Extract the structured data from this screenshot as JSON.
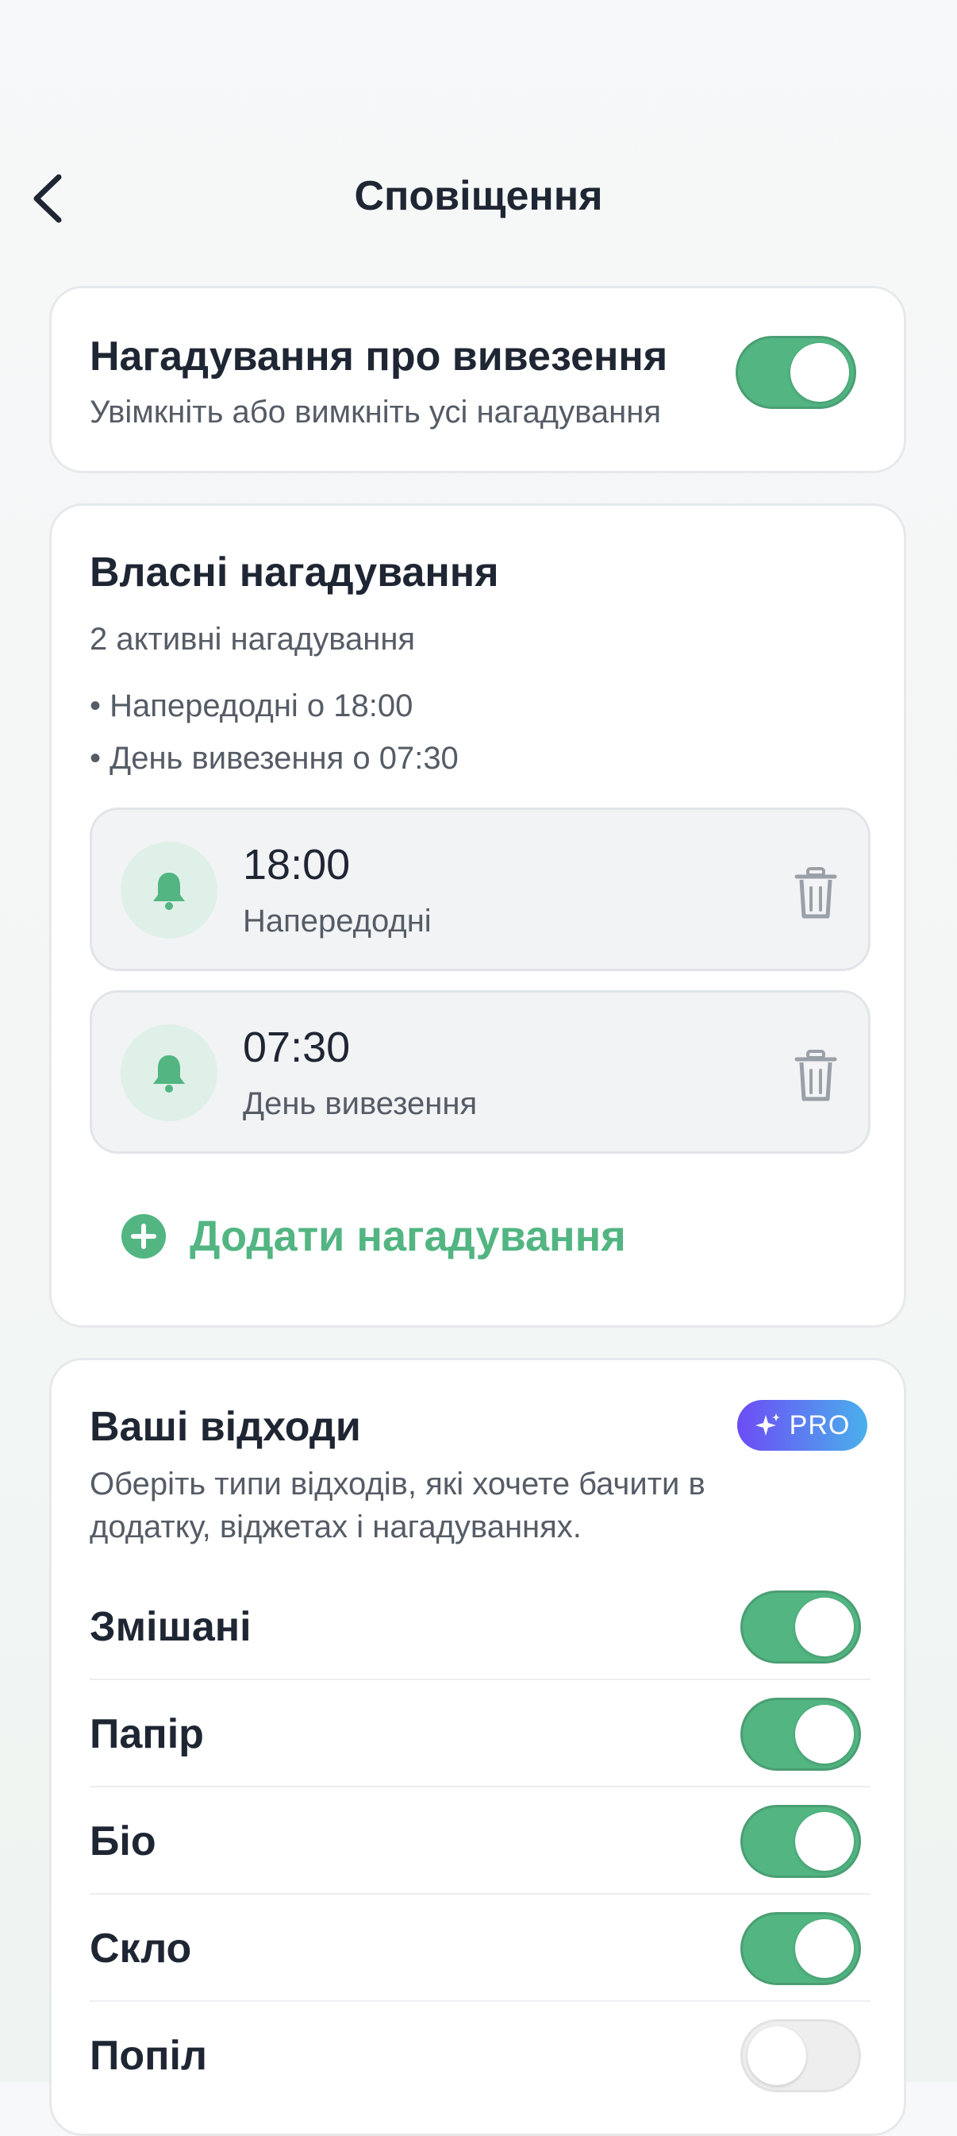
{
  "header": {
    "title": "Сповіщення"
  },
  "master": {
    "title": "Нагадування про вивезення",
    "subtitle": "Увімкніть або вимкніть усі нагадування",
    "enabled": true
  },
  "custom": {
    "title": "Власні нагадування",
    "count_text": "2 активні нагадування",
    "summary": [
      "• Напередодні о 18:00",
      "• День вивезення о 07:30"
    ],
    "reminders": [
      {
        "time": "18:00",
        "label": "Напередодні"
      },
      {
        "time": "07:30",
        "label": "День вивезення"
      }
    ],
    "add_label": "Додати нагадування"
  },
  "waste": {
    "title": "Ваші відходи",
    "pro_badge": "PRO",
    "description_line1": "Оберіть типи відходів, які хочете бачити в",
    "description_line2": "додатку, віджетах і нагадуваннях.",
    "types": [
      {
        "name": "Змішані",
        "enabled": true
      },
      {
        "name": "Папір",
        "enabled": true
      },
      {
        "name": "Біо",
        "enabled": true
      },
      {
        "name": "Скло",
        "enabled": true
      },
      {
        "name": "Попіл",
        "enabled": false
      }
    ]
  },
  "colors": {
    "accent": "#52b582",
    "text": "#1f2633",
    "pro_gradient_start": "#6d4cf5",
    "pro_gradient_end": "#4ab0ec"
  }
}
